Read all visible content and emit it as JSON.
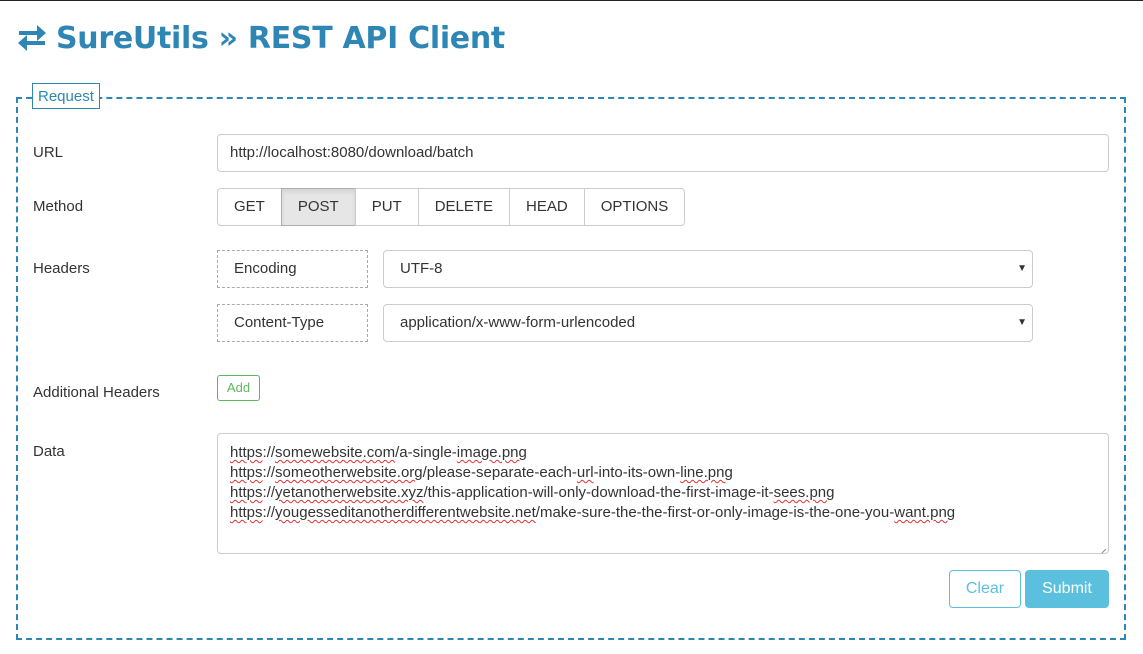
{
  "app": {
    "title": "SureUtils » REST API Client",
    "logo_icon": "swap-arrows-icon",
    "accent_color": "#2e86b5"
  },
  "request": {
    "legend": "Request",
    "url": {
      "label": "URL",
      "value": "http://localhost:8080/download/batch"
    },
    "method": {
      "label": "Method",
      "options": [
        "GET",
        "POST",
        "PUT",
        "DELETE",
        "HEAD",
        "OPTIONS"
      ],
      "selected": "POST"
    },
    "headers": {
      "label": "Headers",
      "items": [
        {
          "key": "Encoding",
          "value": "UTF-8"
        },
        {
          "key": "Content-Type",
          "value": "application/x-www-form-urlencoded"
        }
      ]
    },
    "additional_headers": {
      "label": "Additional Headers",
      "add_label": "Add",
      "add_color": "#5cb85c"
    },
    "data": {
      "label": "Data",
      "lines": [
        "https://somewebsite.com/a-single-image.png",
        "https://someotherwebsite.org/please-separate-each-url-into-its-own-line.png",
        "https://yetanotherwebsite.xyz/this-application-will-only-download-the-first-image-it-sees.png",
        "https://yougesseditanotherdifferentwebsite.net/make-sure-the-the-first-or-only-image-is-the-one-you-want.png"
      ]
    },
    "actions": {
      "clear_label": "Clear",
      "submit_label": "Submit",
      "info_color": "#5bc0de"
    }
  }
}
